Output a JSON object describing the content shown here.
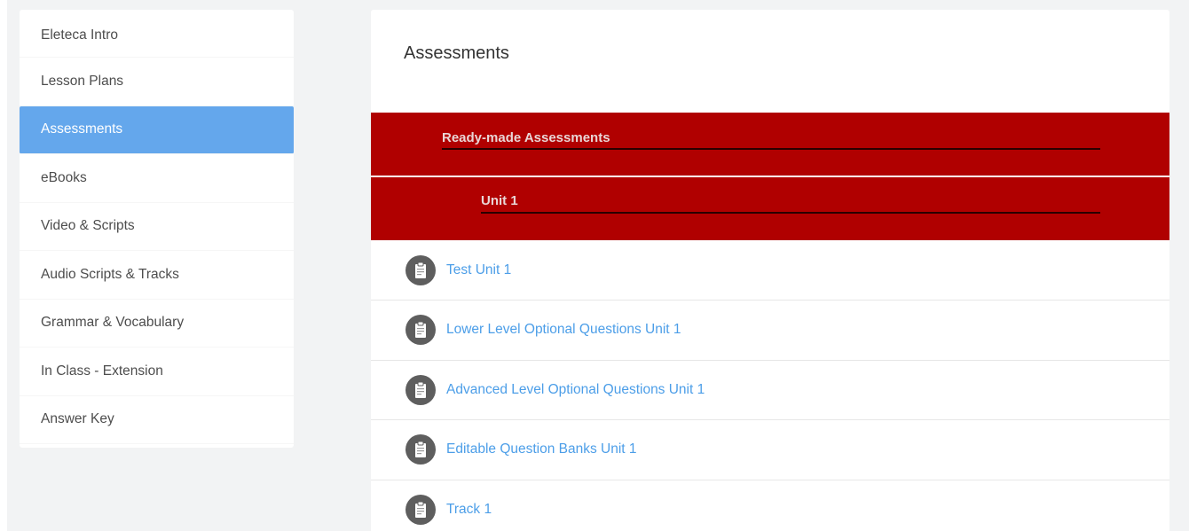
{
  "sidebar": {
    "items": [
      {
        "label": "Eleteca Intro"
      },
      {
        "label": "Lesson Plans"
      },
      {
        "label": "Assessments",
        "active": true
      },
      {
        "label": "eBooks"
      },
      {
        "label": "Video & Scripts"
      },
      {
        "label": "Audio Scripts & Tracks"
      },
      {
        "label": "Grammar & Vocabulary"
      },
      {
        "label": "In Class - Extension"
      },
      {
        "label": "Answer Key"
      }
    ]
  },
  "main": {
    "title": "Assessments",
    "sections": [
      {
        "label": "Ready-made Assessments"
      },
      {
        "label": "Unit 1"
      }
    ],
    "resources": [
      {
        "label": "Test Unit 1",
        "icon": "document-icon"
      },
      {
        "label": "Lower Level Optional Questions Unit 1",
        "icon": "document-icon"
      },
      {
        "label": "Advanced Level Optional Questions Unit 1",
        "icon": "document-icon"
      },
      {
        "label": "Editable Question Banks Unit 1",
        "icon": "document-icon"
      },
      {
        "label": "Track 1",
        "icon": "document-icon"
      }
    ]
  },
  "colors": {
    "accent": "#64a7ec",
    "section_bg": "#b00000",
    "link": "#4c9ee8",
    "icon_bg": "#5e5e5e"
  }
}
